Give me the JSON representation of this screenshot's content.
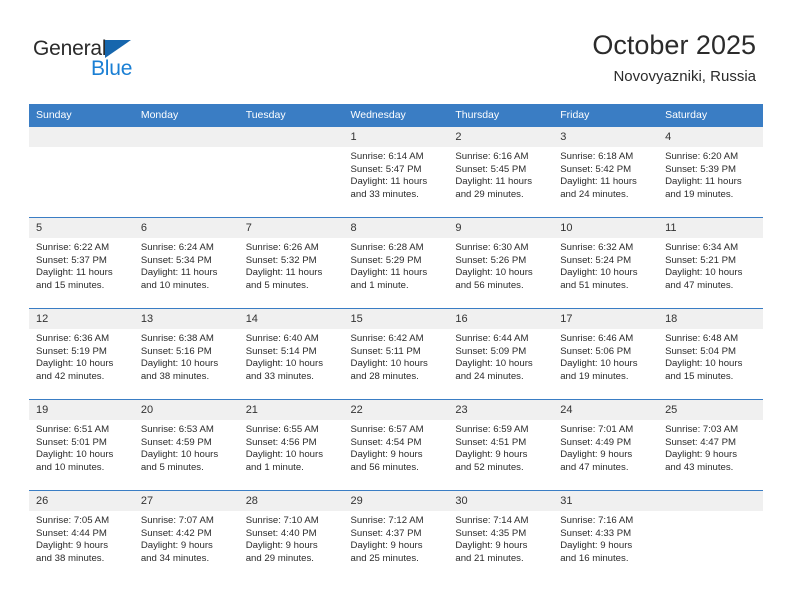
{
  "brand": {
    "line1": "General",
    "line2": "Blue",
    "triangle_color": "#1666ad",
    "blue_text_color": "#1a7fd4"
  },
  "header": {
    "title": "October 2025",
    "subtitle": "Novovyazniki, Russia"
  },
  "theme": {
    "header_blue": "#3a7dc4",
    "daynum_bg": "#f0f0f0",
    "text": "#2b2b2b"
  },
  "calendar": {
    "weekday_headers": [
      "Sunday",
      "Monday",
      "Tuesday",
      "Wednesday",
      "Thursday",
      "Friday",
      "Saturday"
    ],
    "weeks": [
      [
        {
          "day": "",
          "sunrise": "",
          "sunset": "",
          "daylight1": "",
          "daylight2": "",
          "empty": true
        },
        {
          "day": "",
          "sunrise": "",
          "sunset": "",
          "daylight1": "",
          "daylight2": "",
          "empty": true
        },
        {
          "day": "",
          "sunrise": "",
          "sunset": "",
          "daylight1": "",
          "daylight2": "",
          "empty": true
        },
        {
          "day": "1",
          "sunrise": "Sunrise: 6:14 AM",
          "sunset": "Sunset: 5:47 PM",
          "daylight1": "Daylight: 11 hours",
          "daylight2": "and 33 minutes."
        },
        {
          "day": "2",
          "sunrise": "Sunrise: 6:16 AM",
          "sunset": "Sunset: 5:45 PM",
          "daylight1": "Daylight: 11 hours",
          "daylight2": "and 29 minutes."
        },
        {
          "day": "3",
          "sunrise": "Sunrise: 6:18 AM",
          "sunset": "Sunset: 5:42 PM",
          "daylight1": "Daylight: 11 hours",
          "daylight2": "and 24 minutes."
        },
        {
          "day": "4",
          "sunrise": "Sunrise: 6:20 AM",
          "sunset": "Sunset: 5:39 PM",
          "daylight1": "Daylight: 11 hours",
          "daylight2": "and 19 minutes."
        }
      ],
      [
        {
          "day": "5",
          "sunrise": "Sunrise: 6:22 AM",
          "sunset": "Sunset: 5:37 PM",
          "daylight1": "Daylight: 11 hours",
          "daylight2": "and 15 minutes."
        },
        {
          "day": "6",
          "sunrise": "Sunrise: 6:24 AM",
          "sunset": "Sunset: 5:34 PM",
          "daylight1": "Daylight: 11 hours",
          "daylight2": "and 10 minutes."
        },
        {
          "day": "7",
          "sunrise": "Sunrise: 6:26 AM",
          "sunset": "Sunset: 5:32 PM",
          "daylight1": "Daylight: 11 hours",
          "daylight2": "and 5 minutes."
        },
        {
          "day": "8",
          "sunrise": "Sunrise: 6:28 AM",
          "sunset": "Sunset: 5:29 PM",
          "daylight1": "Daylight: 11 hours",
          "daylight2": "and 1 minute."
        },
        {
          "day": "9",
          "sunrise": "Sunrise: 6:30 AM",
          "sunset": "Sunset: 5:26 PM",
          "daylight1": "Daylight: 10 hours",
          "daylight2": "and 56 minutes."
        },
        {
          "day": "10",
          "sunrise": "Sunrise: 6:32 AM",
          "sunset": "Sunset: 5:24 PM",
          "daylight1": "Daylight: 10 hours",
          "daylight2": "and 51 minutes."
        },
        {
          "day": "11",
          "sunrise": "Sunrise: 6:34 AM",
          "sunset": "Sunset: 5:21 PM",
          "daylight1": "Daylight: 10 hours",
          "daylight2": "and 47 minutes."
        }
      ],
      [
        {
          "day": "12",
          "sunrise": "Sunrise: 6:36 AM",
          "sunset": "Sunset: 5:19 PM",
          "daylight1": "Daylight: 10 hours",
          "daylight2": "and 42 minutes."
        },
        {
          "day": "13",
          "sunrise": "Sunrise: 6:38 AM",
          "sunset": "Sunset: 5:16 PM",
          "daylight1": "Daylight: 10 hours",
          "daylight2": "and 38 minutes."
        },
        {
          "day": "14",
          "sunrise": "Sunrise: 6:40 AM",
          "sunset": "Sunset: 5:14 PM",
          "daylight1": "Daylight: 10 hours",
          "daylight2": "and 33 minutes."
        },
        {
          "day": "15",
          "sunrise": "Sunrise: 6:42 AM",
          "sunset": "Sunset: 5:11 PM",
          "daylight1": "Daylight: 10 hours",
          "daylight2": "and 28 minutes."
        },
        {
          "day": "16",
          "sunrise": "Sunrise: 6:44 AM",
          "sunset": "Sunset: 5:09 PM",
          "daylight1": "Daylight: 10 hours",
          "daylight2": "and 24 minutes."
        },
        {
          "day": "17",
          "sunrise": "Sunrise: 6:46 AM",
          "sunset": "Sunset: 5:06 PM",
          "daylight1": "Daylight: 10 hours",
          "daylight2": "and 19 minutes."
        },
        {
          "day": "18",
          "sunrise": "Sunrise: 6:48 AM",
          "sunset": "Sunset: 5:04 PM",
          "daylight1": "Daylight: 10 hours",
          "daylight2": "and 15 minutes."
        }
      ],
      [
        {
          "day": "19",
          "sunrise": "Sunrise: 6:51 AM",
          "sunset": "Sunset: 5:01 PM",
          "daylight1": "Daylight: 10 hours",
          "daylight2": "and 10 minutes."
        },
        {
          "day": "20",
          "sunrise": "Sunrise: 6:53 AM",
          "sunset": "Sunset: 4:59 PM",
          "daylight1": "Daylight: 10 hours",
          "daylight2": "and 5 minutes."
        },
        {
          "day": "21",
          "sunrise": "Sunrise: 6:55 AM",
          "sunset": "Sunset: 4:56 PM",
          "daylight1": "Daylight: 10 hours",
          "daylight2": "and 1 minute."
        },
        {
          "day": "22",
          "sunrise": "Sunrise: 6:57 AM",
          "sunset": "Sunset: 4:54 PM",
          "daylight1": "Daylight: 9 hours",
          "daylight2": "and 56 minutes."
        },
        {
          "day": "23",
          "sunrise": "Sunrise: 6:59 AM",
          "sunset": "Sunset: 4:51 PM",
          "daylight1": "Daylight: 9 hours",
          "daylight2": "and 52 minutes."
        },
        {
          "day": "24",
          "sunrise": "Sunrise: 7:01 AM",
          "sunset": "Sunset: 4:49 PM",
          "daylight1": "Daylight: 9 hours",
          "daylight2": "and 47 minutes."
        },
        {
          "day": "25",
          "sunrise": "Sunrise: 7:03 AM",
          "sunset": "Sunset: 4:47 PM",
          "daylight1": "Daylight: 9 hours",
          "daylight2": "and 43 minutes."
        }
      ],
      [
        {
          "day": "26",
          "sunrise": "Sunrise: 7:05 AM",
          "sunset": "Sunset: 4:44 PM",
          "daylight1": "Daylight: 9 hours",
          "daylight2": "and 38 minutes."
        },
        {
          "day": "27",
          "sunrise": "Sunrise: 7:07 AM",
          "sunset": "Sunset: 4:42 PM",
          "daylight1": "Daylight: 9 hours",
          "daylight2": "and 34 minutes."
        },
        {
          "day": "28",
          "sunrise": "Sunrise: 7:10 AM",
          "sunset": "Sunset: 4:40 PM",
          "daylight1": "Daylight: 9 hours",
          "daylight2": "and 29 minutes."
        },
        {
          "day": "29",
          "sunrise": "Sunrise: 7:12 AM",
          "sunset": "Sunset: 4:37 PM",
          "daylight1": "Daylight: 9 hours",
          "daylight2": "and 25 minutes."
        },
        {
          "day": "30",
          "sunrise": "Sunrise: 7:14 AM",
          "sunset": "Sunset: 4:35 PM",
          "daylight1": "Daylight: 9 hours",
          "daylight2": "and 21 minutes."
        },
        {
          "day": "31",
          "sunrise": "Sunrise: 7:16 AM",
          "sunset": "Sunset: 4:33 PM",
          "daylight1": "Daylight: 9 hours",
          "daylight2": "and 16 minutes."
        },
        {
          "day": "",
          "sunrise": "",
          "sunset": "",
          "daylight1": "",
          "daylight2": "",
          "empty": true
        }
      ]
    ]
  }
}
